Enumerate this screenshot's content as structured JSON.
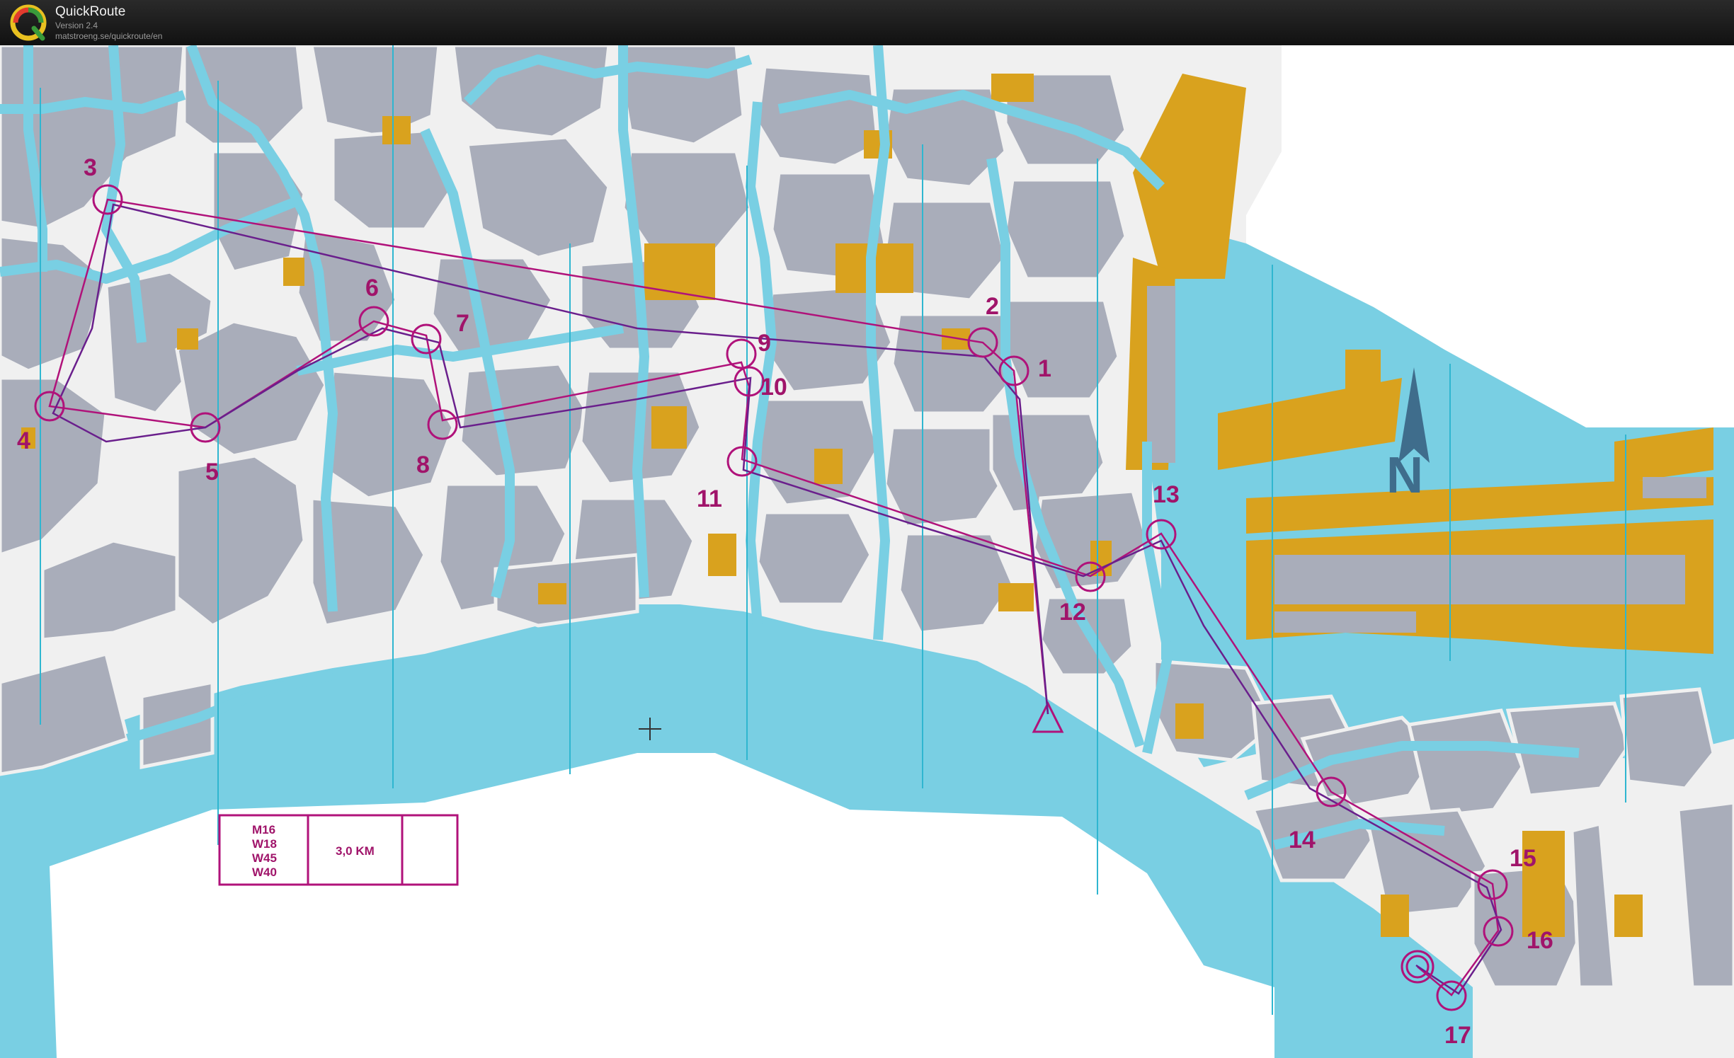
{
  "app": {
    "title": "QuickRoute",
    "version": "Version 2.4",
    "url": "matstroeng.se/quickroute/en",
    "logo_letter": "Q"
  },
  "map": {
    "colors": {
      "water": "#79cfe3",
      "land": "#f0f0f0",
      "building": "#a9adba",
      "highlight": "#d9a21e",
      "course": "#b0127a",
      "route": "#6a1f8c",
      "meridian": "#2fb6d0"
    },
    "north_arrow_label": "N",
    "course_info": {
      "classes": [
        "M16",
        "W18",
        "W45",
        "W40"
      ],
      "length": "3,0 KM"
    },
    "controls": [
      {
        "label": "1"
      },
      {
        "label": "2"
      },
      {
        "label": "3"
      },
      {
        "label": "4"
      },
      {
        "label": "5"
      },
      {
        "label": "6"
      },
      {
        "label": "7"
      },
      {
        "label": "8"
      },
      {
        "label": "9"
      },
      {
        "label": "10"
      },
      {
        "label": "11"
      },
      {
        "label": "12"
      },
      {
        "label": "13"
      },
      {
        "label": "14"
      },
      {
        "label": "15"
      },
      {
        "label": "16"
      },
      {
        "label": "17"
      }
    ]
  }
}
